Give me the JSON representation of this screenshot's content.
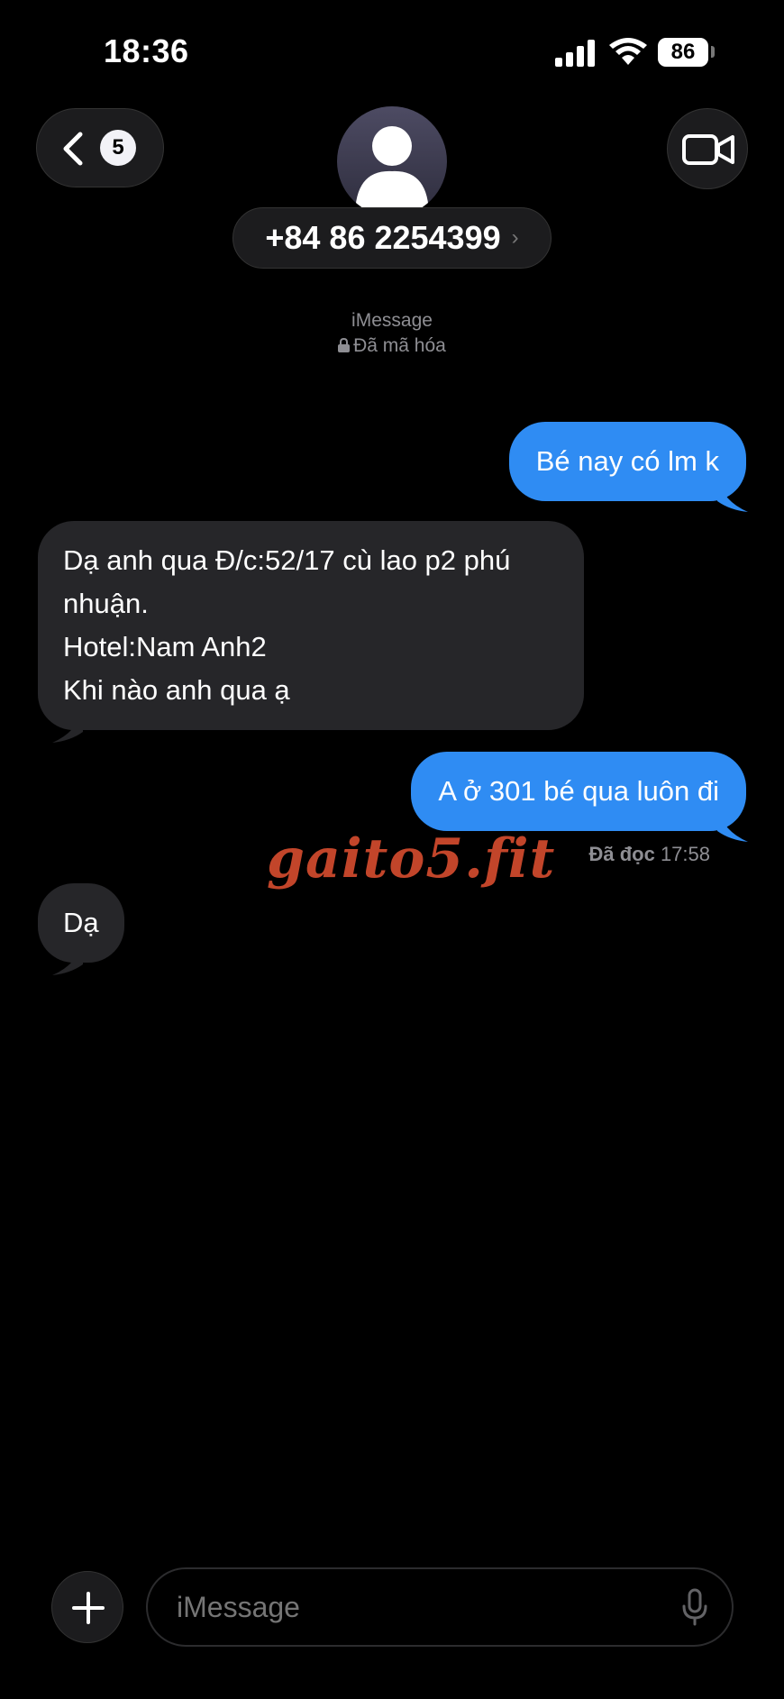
{
  "status_bar": {
    "time": "18:36",
    "battery": "86",
    "icons": [
      "signal-icon",
      "wifi-icon",
      "battery-icon"
    ]
  },
  "header": {
    "back_badge_count": "5",
    "contact": "+84 86 2254399",
    "contact_chevron": "›",
    "icons": [
      "chevron-left-icon",
      "person-avatar-icon",
      "video-camera-icon"
    ]
  },
  "thread": {
    "service": "iMessage",
    "encrypted": "Đã mã hóa",
    "messages": [
      {
        "direction": "outgoing",
        "text": "Bé nay có lm k"
      },
      {
        "direction": "incoming",
        "lines": [
          "Dạ anh qua Đ/c:52/17 cù lao p2 phú",
          "nhuận.",
          "Hotel:Nam Anh2",
          "Khi nào anh qua ạ"
        ]
      },
      {
        "direction": "outgoing",
        "text": "A ở 301 bé qua luôn đi"
      },
      {
        "direction": "incoming",
        "text": "Dạ"
      }
    ],
    "read_receipt": {
      "label": "Đã đọc",
      "time": "17:58"
    }
  },
  "watermark": "gaito5.fit",
  "composer": {
    "placeholder": "iMessage",
    "icons": [
      "plus-icon",
      "microphone-icon"
    ]
  },
  "colors": {
    "background": "#000000",
    "outgoing_bubble": "#2f8cf3",
    "incoming_bubble": "#262629",
    "secondary_text": "#8e8e93",
    "watermark": "#c2452a"
  }
}
